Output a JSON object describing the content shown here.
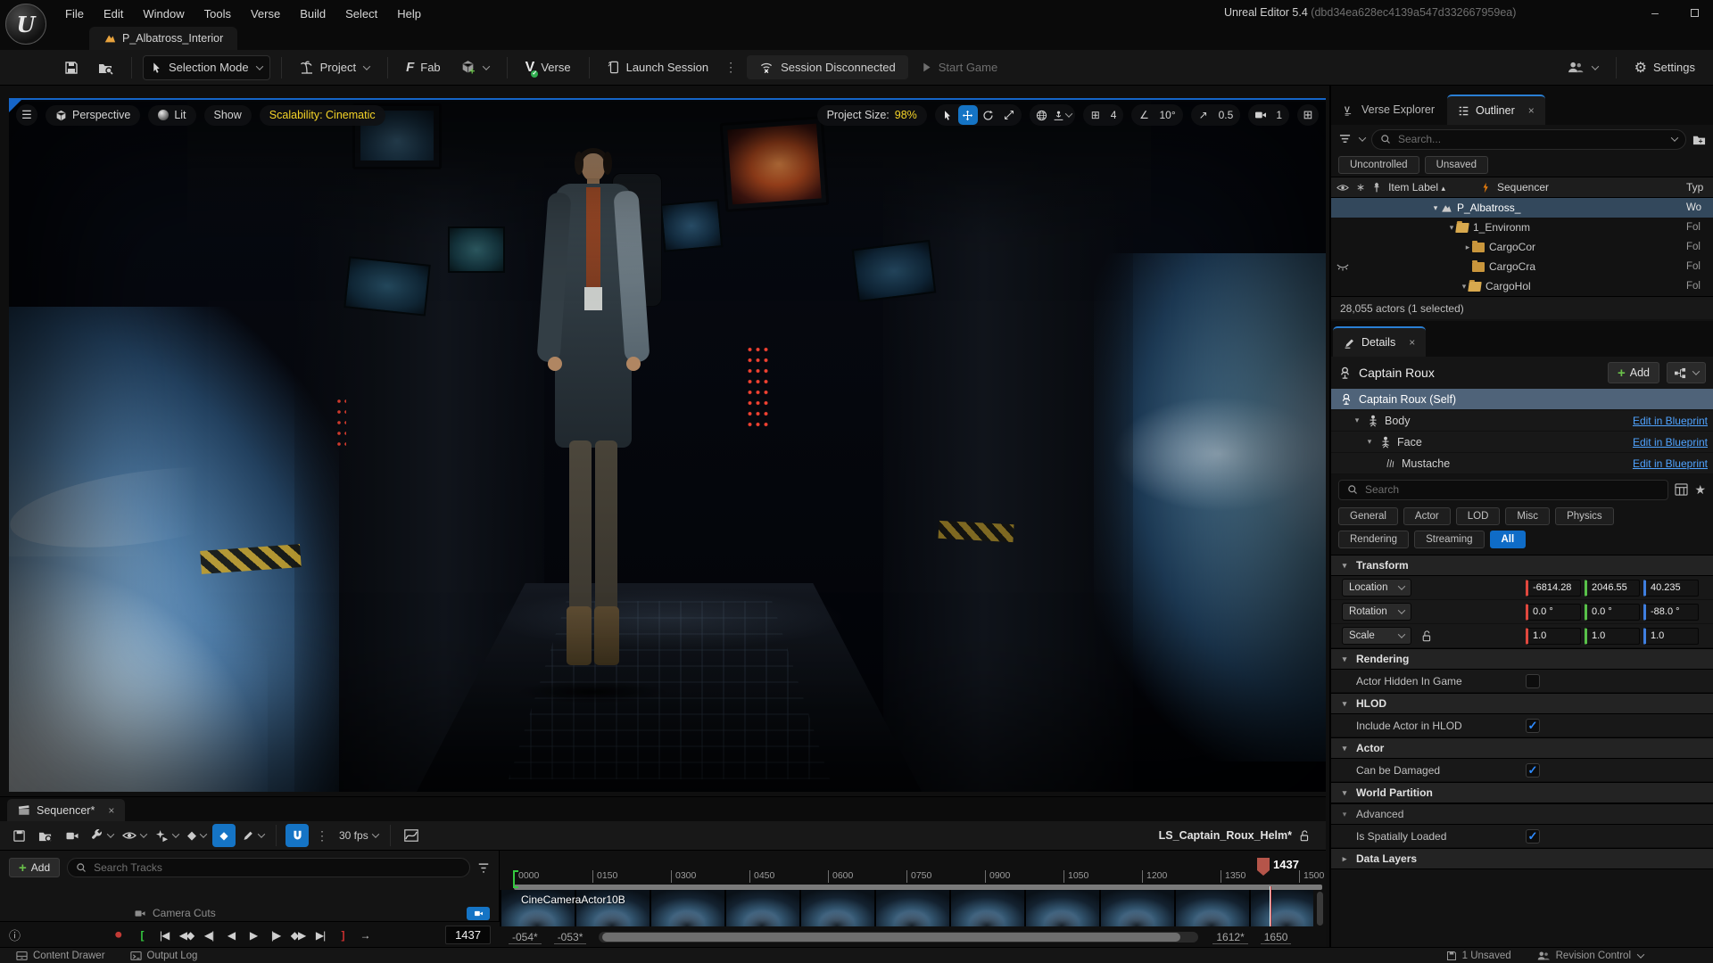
{
  "titlebar": {
    "title": "Unreal Editor 5.4",
    "build_id": "(dbd34ea628ec4139a547d332667959ea)"
  },
  "menu": {
    "items": [
      "File",
      "Edit",
      "Window",
      "Tools",
      "Verse",
      "Build",
      "Select",
      "Help"
    ]
  },
  "level_tab": "P_Albatross_Interior",
  "toolbar": {
    "selection_mode": "Selection Mode",
    "project": "Project",
    "fab": "Fab",
    "verse": "Verse",
    "launch_session": "Launch Session",
    "session_status": "Session Disconnected",
    "start_game": "Start Game",
    "settings": "Settings"
  },
  "viewport": {
    "perspective": "Perspective",
    "lit": "Lit",
    "show": "Show",
    "scalability": "Scalability: Cinematic",
    "project_size_label": "Project Size:",
    "project_size_value": "98%",
    "snap": {
      "grid": "4",
      "angle": "10°",
      "scale": "0.5",
      "camera_speed": "1"
    }
  },
  "outliner": {
    "tab_verse_explorer": "Verse Explorer",
    "tab_outliner": "Outliner",
    "search_placeholder": "Search...",
    "buttons": {
      "uncontrolled": "Uncontrolled",
      "unsaved": "Unsaved"
    },
    "columns": {
      "item_label": "Item Label",
      "sequencer": "Sequencer",
      "type": "Typ"
    },
    "rows": [
      {
        "label": "P_Albatross_",
        "type": "Wo"
      },
      {
        "label": "1_Environm",
        "type": "Fol"
      },
      {
        "label": "CargoCor",
        "type": "Fol"
      },
      {
        "label": "CargoCra",
        "type": "Fol"
      },
      {
        "label": "CargoHol",
        "type": "Fol"
      }
    ],
    "status": "28,055 actors (1 selected)"
  },
  "details": {
    "tab": "Details",
    "actor_name": "Captain Roux",
    "add_label": "Add",
    "components": [
      {
        "name": "Captain Roux (Self)"
      },
      {
        "name": "Body",
        "action": "Edit in Blueprint"
      },
      {
        "name": "Face",
        "action": "Edit in Blueprint"
      },
      {
        "name": "Mustache",
        "action": "Edit in Blueprint"
      }
    ],
    "search_placeholder": "Search",
    "chips": [
      "General",
      "Actor",
      "LOD",
      "Misc",
      "Physics",
      "Rendering",
      "Streaming",
      "All"
    ],
    "transform": {
      "title": "Transform",
      "location_label": "Location",
      "rotation_label": "Rotation",
      "scale_label": "Scale",
      "location": [
        "-6814.28",
        "2046.55",
        "40.235"
      ],
      "rotation": [
        "0.0 °",
        "0.0 °",
        "-88.0 °"
      ],
      "scale": [
        "1.0",
        "1.0",
        "1.0"
      ]
    },
    "sections": {
      "rendering_title": "Rendering",
      "actor_hidden": "Actor Hidden In Game",
      "hlod_title": "HLOD",
      "include_hlod": "Include Actor in HLOD",
      "actor_title": "Actor",
      "can_be_damaged": "Can be Damaged",
      "world_partition_title": "World Partition",
      "advanced_title": "Advanced",
      "is_spatially_loaded": "Is Spatially Loaded",
      "data_layers_title": "Data Layers"
    }
  },
  "sequencer": {
    "tab": "Sequencer*",
    "fps": "30 fps",
    "add_label": "Add",
    "search_placeholder": "Search Tracks",
    "sequence_name": "LS_Captain_Roux_Helm*",
    "camera_cuts_label": "Camera Cuts",
    "track_label": "CineCameraActor10B",
    "ticks": [
      "0000",
      "0150",
      "0300",
      "0450",
      "0600",
      "0750",
      "0900",
      "1050",
      "1200",
      "1350",
      "1500"
    ],
    "playhead": "1437",
    "current_frame": "1437",
    "fields": {
      "start_a": "-054*",
      "start_b": "-053*",
      "end_a": "1612*",
      "end_b": "1650"
    }
  },
  "statusbar": {
    "content_drawer": "Content Drawer",
    "output_log": "Output Log",
    "unsaved": "1 Unsaved",
    "revision_control": "Revision Control"
  },
  "colors": {
    "accent_blue": "#1574c5",
    "selection_row": "#33485c",
    "yellow": "#f5d428",
    "link_blue": "#4fa3ff",
    "axis_x": "#e0483e",
    "axis_y": "#58c149",
    "axis_z": "#3f7fe0",
    "record_red": "#c23a35",
    "bracket_green": "#35c940",
    "folder": "#c9963c",
    "bolt_orange": "#e87d0d"
  }
}
